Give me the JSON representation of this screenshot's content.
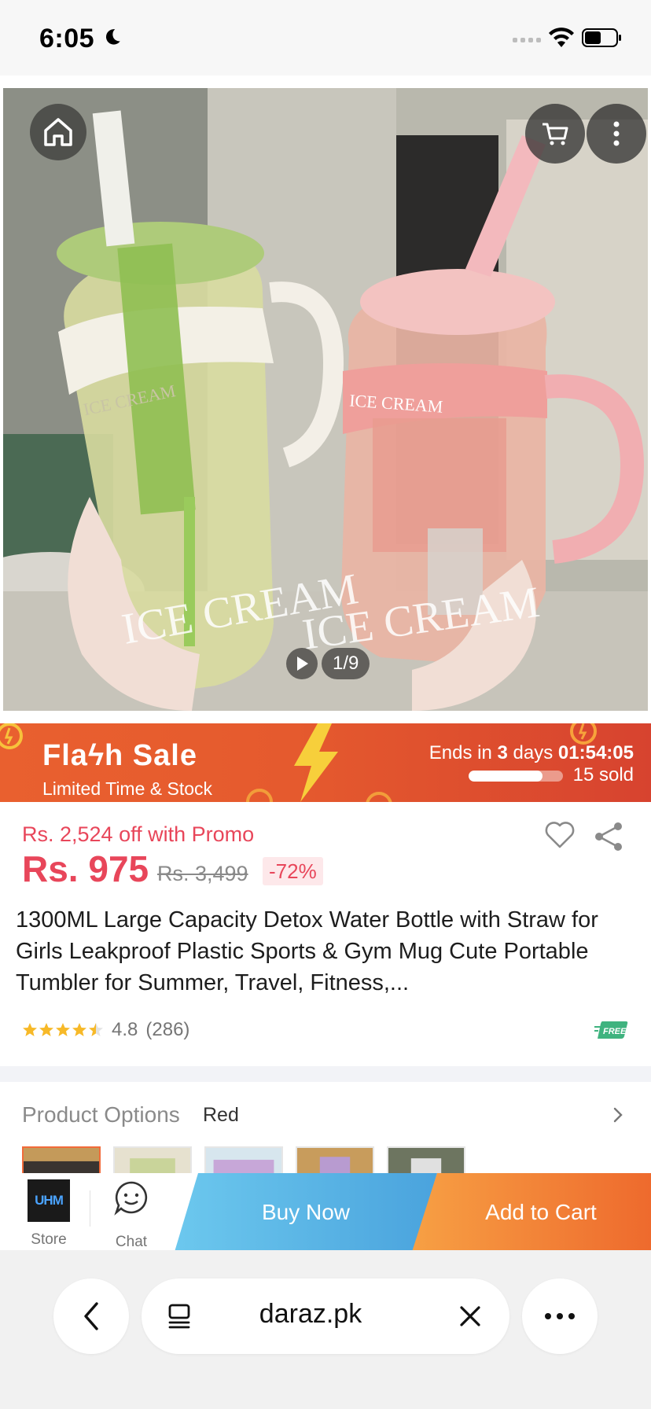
{
  "status_bar": {
    "time": "6:05"
  },
  "gallery": {
    "counter": "1/9",
    "bottle_text": "ICE CREAM"
  },
  "flash_sale": {
    "title": "Flaϟh Sale",
    "subtitle": "Limited Time & Stock",
    "ends_prefix": "Ends in",
    "ends_days": "3",
    "ends_days_suffix": "days",
    "ends_time": "01:54:05",
    "sold": "15 sold",
    "sold_progress": 0.78
  },
  "product": {
    "promo": "Rs. 2,524 off with Promo",
    "price": "Rs. 975",
    "old_price": "Rs. 3,499",
    "discount": "-72%",
    "title": "1300ML Large Capacity Detox Water Bottle with Straw for Girls Leakproof Plastic Sports & Gym Mug Cute Portable Tumbler for Summer, Travel, Fitness,...",
    "rating": "4.8",
    "rating_count": "(286)",
    "rating_stars": 4.5,
    "free_badge": "FREE"
  },
  "options": {
    "label": "Product Options",
    "value": "Red"
  },
  "action_bar": {
    "store_logo": "UHM",
    "store_label": "Store",
    "chat_label": "Chat",
    "buy_now": "Buy Now",
    "add_to_cart": "Add to Cart"
  },
  "browser": {
    "url": "daraz.pk"
  },
  "colors": {
    "accent_red": "#e8465a",
    "flash_orange": "#e55a2e",
    "buy_blue": "#4aa3dd",
    "cart_orange": "#ee6a2d"
  }
}
